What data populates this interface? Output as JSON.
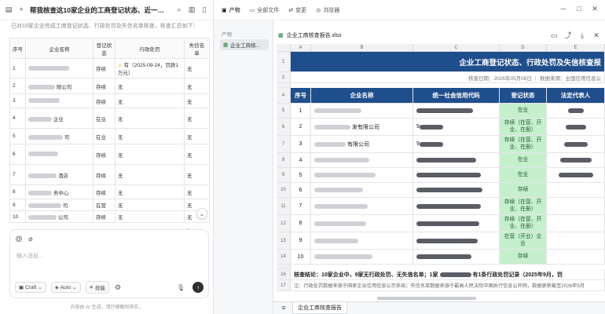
{
  "chat": {
    "title": "帮我核查这10家企业的工商登记状态、近一年行政处罚记录...",
    "subtitle": "已对10家企业完成工商登记状态、行政处罚及失信名单核查，核查汇总如下：",
    "table_headers": [
      "序号",
      "企业名称",
      "登记状态",
      "行政处罚",
      "失信名单"
    ],
    "rows": [
      {
        "no": "1",
        "name_suffix": "",
        "status": "存续",
        "penalty": "有（2025-09-24，罚款1万元）",
        "dishonest": "无",
        "warn": true
      },
      {
        "no": "2",
        "name_suffix": "限公司",
        "status": "存续",
        "penalty": "无",
        "dishonest": "无",
        "warn": false
      },
      {
        "no": "3",
        "name_suffix": "",
        "status": "存续",
        "penalty": "无",
        "dishonest": "无",
        "warn": false
      },
      {
        "no": "4",
        "name_suffix": "企业",
        "status": "在业",
        "penalty": "无",
        "dishonest": "无",
        "warn": false
      },
      {
        "no": "5",
        "name_suffix": "司",
        "status": "在业",
        "penalty": "无",
        "dishonest": "无",
        "warn": false
      },
      {
        "no": "6",
        "name_suffix": "",
        "status": "存续",
        "penalty": "无",
        "dishonest": "无",
        "warn": false
      },
      {
        "no": "7",
        "name_suffix": "酒店",
        "status": "存续",
        "penalty": "无",
        "dishonest": "无",
        "warn": false
      },
      {
        "no": "8",
        "name_suffix": "务中心",
        "status": "存续",
        "penalty": "无",
        "dishonest": "无",
        "warn": false
      },
      {
        "no": "9",
        "name_suffix": "司",
        "status": "在营",
        "penalty": "无",
        "dishonest": "无",
        "warn": false
      },
      {
        "no": "10",
        "name_suffix": "公司",
        "status": "存续",
        "penalty": "无",
        "dishonest": "无",
        "warn": false
      }
    ],
    "input_placeholder": "输入消息...",
    "model_label": "Craft",
    "mode_label": "Auto",
    "skills_label": "技能",
    "disclaimer": "内容由 AI 生成，请仔细甄别核实。"
  },
  "middle": {
    "section_label": "产物",
    "file_label": "企业工商核..."
  },
  "tabs": [
    {
      "label": "产物",
      "icon": "box-icon"
    },
    {
      "label": "全部文件",
      "icon": "folder-icon"
    },
    {
      "label": "变更",
      "icon": "diff-icon"
    },
    {
      "label": "浏览器",
      "icon": "globe-icon"
    }
  ],
  "file": {
    "name": "企业工商核查报告.xlsx"
  },
  "sheet": {
    "col_letters": [
      "A",
      "B",
      "C",
      "D",
      "E"
    ],
    "banner": "企业工商登记状态、行政处罚及失信核查报",
    "meta": "核查日期：2026年05月08日 ｜ 数据来源：全国信用信息公",
    "headers": [
      "序号",
      "企业名称",
      "统一社会信用代码",
      "登记状态",
      "法定代表人"
    ],
    "rows": [
      {
        "r": "5",
        "no": "1",
        "name": "",
        "code": "",
        "status": "在业"
      },
      {
        "r": "6",
        "no": "2",
        "name": "发有限公司",
        "code": "9",
        "status": "存续（在营、开业、在册）"
      },
      {
        "r": "7",
        "no": "3",
        "name": "有限公司",
        "code": "9",
        "status": "存续（在营、开业、在册）"
      },
      {
        "r": "8",
        "no": "4",
        "name": "",
        "code": "",
        "status": "在业"
      },
      {
        "r": "9",
        "no": "5",
        "name": "",
        "code": "",
        "status": "在业"
      },
      {
        "r": "10",
        "no": "6",
        "name": "",
        "code": "",
        "status": "存续"
      },
      {
        "r": "11",
        "no": "7",
        "name": "",
        "code": "",
        "status": "存续（在营、开业、在册）"
      },
      {
        "r": "12",
        "no": "8",
        "name": "",
        "code": "",
        "status": "存续（在营、开业、在册）"
      },
      {
        "r": "13",
        "no": "9",
        "name": "",
        "code": "",
        "status": "在营（开业）企业"
      },
      {
        "r": "14",
        "no": "10",
        "name": "",
        "code": "",
        "status": "存续"
      }
    ],
    "row_numbers_top": [
      "1",
      "2",
      "3",
      "4"
    ],
    "conclusion_row": "16",
    "conclusion": "核查结论：10家企业中，9家无行政处罚、无失信名单；1家",
    "conclusion_tail": "有1条行政处罚记录（2025年9月，罚",
    "note_row": "17",
    "note": "注：行政处罚数据来源于国家企业信用信息公示系统；失信名单数据来源于最高人民法院中国执行信息公开网，数据更新截至2026年5月",
    "sheet_tab": "企业工商核查报告"
  }
}
